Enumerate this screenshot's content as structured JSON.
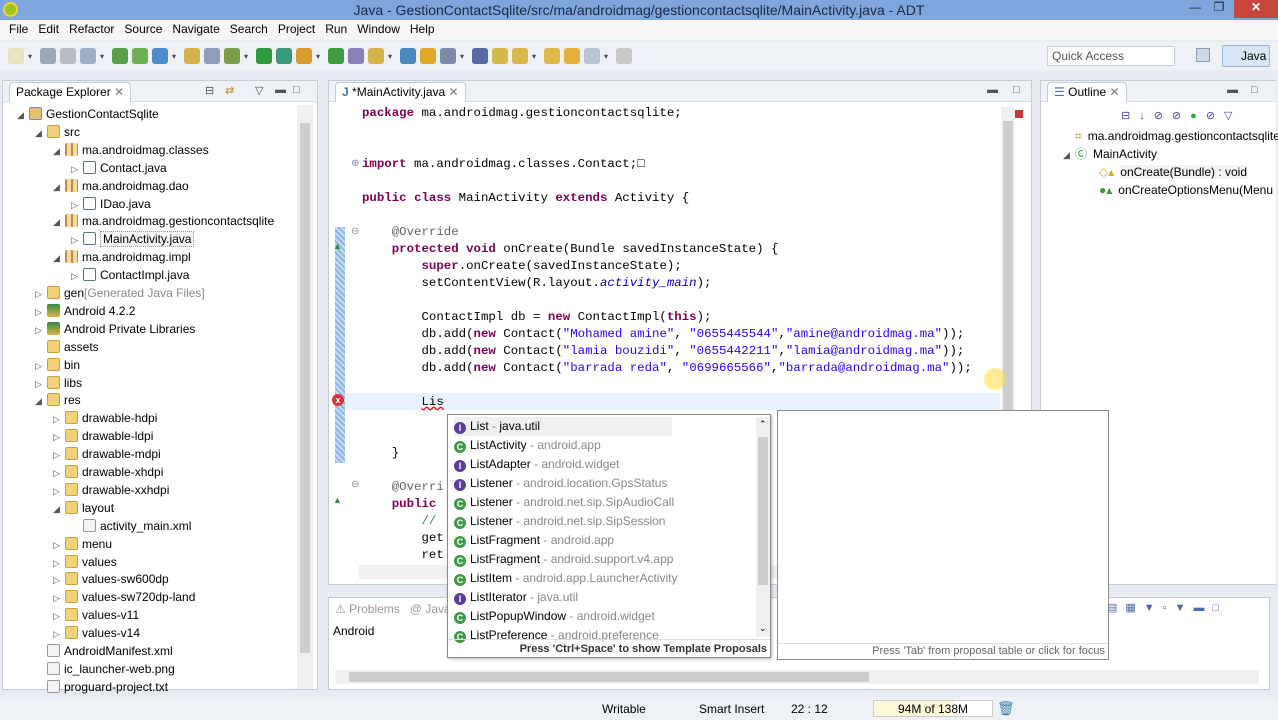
{
  "window": {
    "title": "Java - GestionContactSqlite/src/ma/androidmag/gestioncontactsqlite/MainActivity.java - ADT"
  },
  "menu": [
    "File",
    "Edit",
    "Refactor",
    "Source",
    "Navigate",
    "Search",
    "Project",
    "Run",
    "Window",
    "Help"
  ],
  "quick_access": {
    "placeholder": "Quick Access"
  },
  "perspective": {
    "label": "Java"
  },
  "package_explorer": {
    "title": "Package Explorer",
    "items": [
      {
        "label": "GestionContactSqlite",
        "level": 0,
        "icon": "project",
        "expanded": true
      },
      {
        "label": "src",
        "level": 1,
        "icon": "folder",
        "expanded": true
      },
      {
        "label": "ma.androidmag.classes",
        "level": 2,
        "icon": "package",
        "expanded": true
      },
      {
        "label": "Contact.java",
        "level": 3,
        "icon": "java",
        "expanded": false
      },
      {
        "label": "ma.androidmag.dao",
        "level": 2,
        "icon": "package",
        "expanded": true
      },
      {
        "label": "IDao.java",
        "level": 3,
        "icon": "java",
        "expanded": false
      },
      {
        "label": "ma.androidmag.gestioncontactsqlite",
        "level": 2,
        "icon": "package",
        "expanded": true
      },
      {
        "label": "MainActivity.java",
        "level": 3,
        "icon": "java",
        "expanded": false,
        "selected": true
      },
      {
        "label": "ma.androidmag.impl",
        "level": 2,
        "icon": "package",
        "expanded": true
      },
      {
        "label": "ContactImpl.java",
        "level": 3,
        "icon": "java",
        "expanded": false
      },
      {
        "label": "gen",
        "suffix": "[Generated Java Files]",
        "level": 1,
        "icon": "folder",
        "expanded": false
      },
      {
        "label": "Android 4.2.2",
        "level": 1,
        "icon": "library",
        "expanded": false
      },
      {
        "label": "Android Private Libraries",
        "level": 1,
        "icon": "library",
        "expanded": false
      },
      {
        "label": "assets",
        "level": 1,
        "icon": "folder",
        "leaf": true
      },
      {
        "label": "bin",
        "level": 1,
        "icon": "folder",
        "expanded": false
      },
      {
        "label": "libs",
        "level": 1,
        "icon": "folder",
        "expanded": false
      },
      {
        "label": "res",
        "level": 1,
        "icon": "folder",
        "expanded": true
      },
      {
        "label": "drawable-hdpi",
        "level": 2,
        "icon": "folder",
        "expanded": false
      },
      {
        "label": "drawable-ldpi",
        "level": 2,
        "icon": "folder",
        "expanded": false
      },
      {
        "label": "drawable-mdpi",
        "level": 2,
        "icon": "folder",
        "expanded": false
      },
      {
        "label": "drawable-xhdpi",
        "level": 2,
        "icon": "folder",
        "expanded": false
      },
      {
        "label": "drawable-xxhdpi",
        "level": 2,
        "icon": "folder",
        "expanded": false
      },
      {
        "label": "layout",
        "level": 2,
        "icon": "folder",
        "expanded": true
      },
      {
        "label": "activity_main.xml",
        "level": 3,
        "icon": "file",
        "leaf": true
      },
      {
        "label": "menu",
        "level": 2,
        "icon": "folder",
        "expanded": false
      },
      {
        "label": "values",
        "level": 2,
        "icon": "folder",
        "expanded": false
      },
      {
        "label": "values-sw600dp",
        "level": 2,
        "icon": "folder",
        "expanded": false
      },
      {
        "label": "values-sw720dp-land",
        "level": 2,
        "icon": "folder",
        "expanded": false
      },
      {
        "label": "values-v11",
        "level": 2,
        "icon": "folder",
        "expanded": false
      },
      {
        "label": "values-v14",
        "level": 2,
        "icon": "folder",
        "expanded": false
      },
      {
        "label": "AndroidManifest.xml",
        "level": 1,
        "icon": "file",
        "leaf": true
      },
      {
        "label": "ic_launcher-web.png",
        "level": 1,
        "icon": "file",
        "leaf": true
      },
      {
        "label": "proguard-project.txt",
        "level": 1,
        "icon": "file",
        "leaf": true
      }
    ]
  },
  "editor": {
    "tab": "*MainActivity.java",
    "lines": [
      "package ma.androidmag.gestioncontactsqlite;",
      "",
      "",
      "import ma.androidmag.classes.Contact;□",
      "",
      "public class MainActivity extends Activity {",
      "",
      "    @Override",
      "    protected void onCreate(Bundle savedInstanceState) {",
      "        super.onCreate(savedInstanceState);",
      "        setContentView(R.layout.activity_main);",
      "",
      "        ContactImpl db = new ContactImpl(this);",
      "        db.add(new Contact(\"Mohamed amine\", \"0655445544\",\"amine@androidmag.ma\"));",
      "        db.add(new Contact(\"lamia bouzidi\", \"0655442211\",\"lamia@androidmag.ma\"));",
      "        db.add(new Contact(\"barrada reda\", \"0699665566\",\"barrada@androidmag.ma\"));",
      "",
      "        Lis",
      "",
      "",
      "    }",
      "",
      "    @Overri",
      "    public ",
      "        // ",
      "        get",
      "        ret"
    ]
  },
  "completion": {
    "items": [
      {
        "name": "List",
        "pkg": "java.util",
        "kind": "interface"
      },
      {
        "name": "ListActivity",
        "pkg": "android.app",
        "kind": "class"
      },
      {
        "name": "ListAdapter",
        "pkg": "android.widget",
        "kind": "interface"
      },
      {
        "name": "Listener",
        "pkg": "android.location.GpsStatus",
        "kind": "interface"
      },
      {
        "name": "Listener",
        "pkg": "android.net.sip.SipAudioCall",
        "kind": "class"
      },
      {
        "name": "Listener",
        "pkg": "android.net.sip.SipSession",
        "kind": "class"
      },
      {
        "name": "ListFragment",
        "pkg": "android.app",
        "kind": "class"
      },
      {
        "name": "ListFragment",
        "pkg": "android.support.v4.app",
        "kind": "class"
      },
      {
        "name": "ListItem",
        "pkg": "android.app.LauncherActivity",
        "kind": "class"
      },
      {
        "name": "ListIterator",
        "pkg": "java.util",
        "kind": "interface"
      },
      {
        "name": "ListPopupWindow",
        "pkg": "android.widget",
        "kind": "class"
      },
      {
        "name": "ListPreference",
        "pkg": "android.preference",
        "kind": "class"
      }
    ],
    "footer": "Press 'Ctrl+Space' to show Template Proposals",
    "info_footer": "Press 'Tab' from proposal table or click for focus"
  },
  "outline": {
    "title": "Outline",
    "items": [
      {
        "label": "ma.androidmag.gestioncontactsqlite",
        "level": 0
      },
      {
        "label": "MainActivity",
        "level": 0
      },
      {
        "label": "onCreate(Bundle) : void",
        "level": 1
      },
      {
        "label": "onCreateOptionsMenu(Menu",
        "level": 1
      }
    ]
  },
  "bottom": {
    "tabs": [
      "Problems",
      "Java"
    ],
    "row": "Android"
  },
  "status": {
    "writable": "Writable",
    "insert": "Smart Insert",
    "position": "22 : 12",
    "heap": "94M of 138M",
    "heap_fraction": 0.68
  }
}
